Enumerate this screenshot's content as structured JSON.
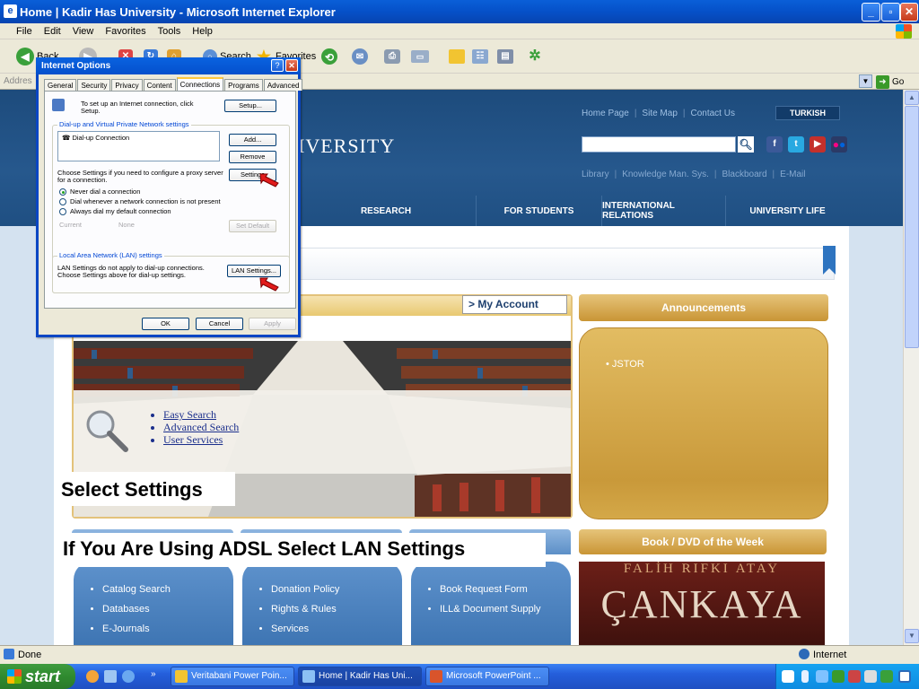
{
  "window": {
    "title": "Home | Kadir Has University - Microsoft Internet Explorer",
    "menu": [
      "File",
      "Edit",
      "View",
      "Favorites",
      "Tools",
      "Help"
    ],
    "toolbar": {
      "back": "Back",
      "search": "Search",
      "favorites": "Favorites"
    },
    "address_label": "Addres",
    "go_label": "Go"
  },
  "site": {
    "name_fragment": "IVERSITY",
    "top_links": [
      "Home Page",
      "Site Map",
      "Contact Us"
    ],
    "turkish": "TURKISH",
    "sub_links": [
      "Library",
      "Knowledge Man. Sys.",
      "Blackboard",
      "E-Mail"
    ],
    "nav": [
      "RESEARCH",
      "FOR STUDENTS",
      "INTERNATIONAL RELATIONS",
      "UNIVERSITY LIFE"
    ],
    "my_account": "My Account",
    "library_links": [
      "Easy Search",
      "Advanced Search",
      "User Services"
    ],
    "announcements": {
      "title": "Announcements",
      "items": [
        "JSTOR"
      ]
    },
    "book": {
      "title": "Book / DVD of the Week",
      "author": "FALİH RIFKI ATAY",
      "book_title": "ÇANKAYA"
    },
    "columns": [
      [
        "Catalog Search",
        "Databases",
        "E-Journals"
      ],
      [
        "Donation Policy",
        "Rights & Rules",
        "Services"
      ],
      [
        "Book Request Form",
        "ILL& Document Supply"
      ]
    ]
  },
  "callouts": {
    "select_settings": "Select Settings",
    "adsl": "If You Are Using ADSL Select LAN Settings"
  },
  "dialog": {
    "title": "Internet Options",
    "tabs": [
      "General",
      "Security",
      "Privacy",
      "Content",
      "Connections",
      "Programs",
      "Advanced"
    ],
    "active_tab": "Connections",
    "setup_text": "To set up an Internet connection, click Setup.",
    "setup_btn": "Setup...",
    "dialup_group": "Dial-up and Virtual Private Network settings",
    "dialup_item": "Dial-up Connection",
    "add_btn": "Add...",
    "remove_btn": "Remove",
    "proxy_text": "Choose Settings if you need to configure a proxy server for a connection.",
    "settings_btn": "Settings",
    "radios": [
      "Never dial a connection",
      "Dial whenever a network connection is not present",
      "Always dial my default connection"
    ],
    "selected_radio": 0,
    "current_label": "Current",
    "current_value": "None",
    "set_default_btn": "Set Default",
    "lan_group": "Local Area Network (LAN) settings",
    "lan_text": "LAN Settings do not apply to dial-up connections. Choose Settings above for dial-up settings.",
    "lan_btn": "LAN Settings...",
    "ok": "OK",
    "cancel": "Cancel",
    "apply": "Apply"
  },
  "status": {
    "text": "Done",
    "zone": "Internet"
  },
  "taskbar": {
    "start": "start",
    "tasks": [
      "Veritabani Power Poin...",
      "Home | Kadir Has Uni...",
      "Microsoft PowerPoint ..."
    ]
  }
}
